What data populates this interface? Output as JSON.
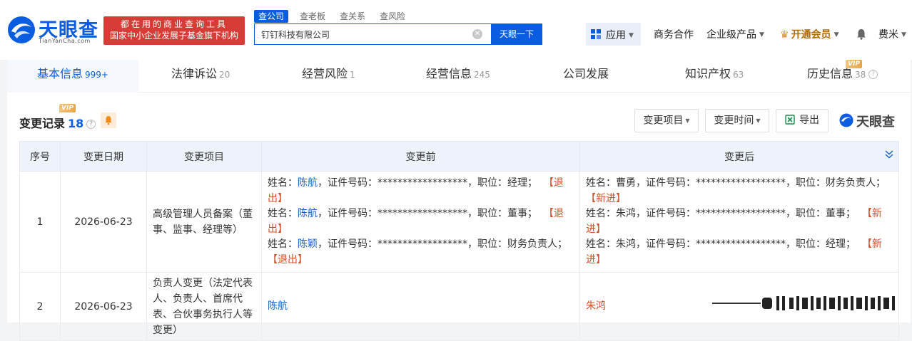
{
  "header": {
    "logo_text": "天眼查",
    "logo_sub": "TianYanCha.com",
    "promo_line1": "都在用的商业查询工具",
    "promo_line2": "国家中小企业发展子基金旗下机构",
    "search_tabs": [
      "查公司",
      "查老板",
      "查关系",
      "查风险"
    ],
    "search_value": "钉钉科技有限公司",
    "search_button": "天眼一下",
    "apps_label": "应用",
    "nav": [
      "商务合作",
      "企业级产品",
      "开通会员"
    ],
    "user": "费米"
  },
  "tabs": [
    {
      "label": "基本信息",
      "count": "999+"
    },
    {
      "label": "法律诉讼",
      "count": "20"
    },
    {
      "label": "经营风险",
      "count": "1"
    },
    {
      "label": "经营信息",
      "count": "245"
    },
    {
      "label": "公司发展",
      "count": ""
    },
    {
      "label": "知识产权",
      "count": "63"
    },
    {
      "label": "历史信息",
      "count": "38"
    }
  ],
  "vip_label": "VIP",
  "section": {
    "title": "变更记录",
    "count": "18",
    "btn_item": "变更项目",
    "btn_time": "变更时间",
    "btn_export": "导出",
    "watermark": "天眼查"
  },
  "table": {
    "headers": [
      "序号",
      "变更日期",
      "变更项目",
      "变更前",
      "变更后"
    ],
    "rows": [
      {
        "idx": "1",
        "date": "2026-06-23",
        "item": "高级管理人员备案（董事、监事、经理等）",
        "before": [
          {
            "pre": "姓名：",
            "name": "陈航",
            "post": "，证件号码：******************，职位：经理；",
            "tag": "【退出】"
          },
          {
            "pre": "姓名：",
            "name": "陈航",
            "post": "，证件号码：******************，职位：董事；",
            "tag": "【退出】"
          },
          {
            "pre": "姓名：",
            "name": "陈颖",
            "post": "，证件号码：******************，职位：财务负责人；",
            "tag": "【退出】"
          }
        ],
        "after": [
          {
            "text": "姓名：曹勇，证件号码：******************，职位：财务负责人；",
            "tag": "【新进】"
          },
          {
            "text": "姓名：朱鸿，证件号码：******************，职位：董事；",
            "tag": "【新进】"
          },
          {
            "text": "姓名：朱鸿，证件号码：******************，职位：经理；",
            "tag": "【新进】"
          }
        ]
      },
      {
        "idx": "2",
        "date": "2026-06-23",
        "item": "负责人变更（法定代表人、负责人、首席代表、合伙事务执行人等变更）",
        "before_name": "陈航",
        "after_name": "朱鸿"
      }
    ]
  }
}
